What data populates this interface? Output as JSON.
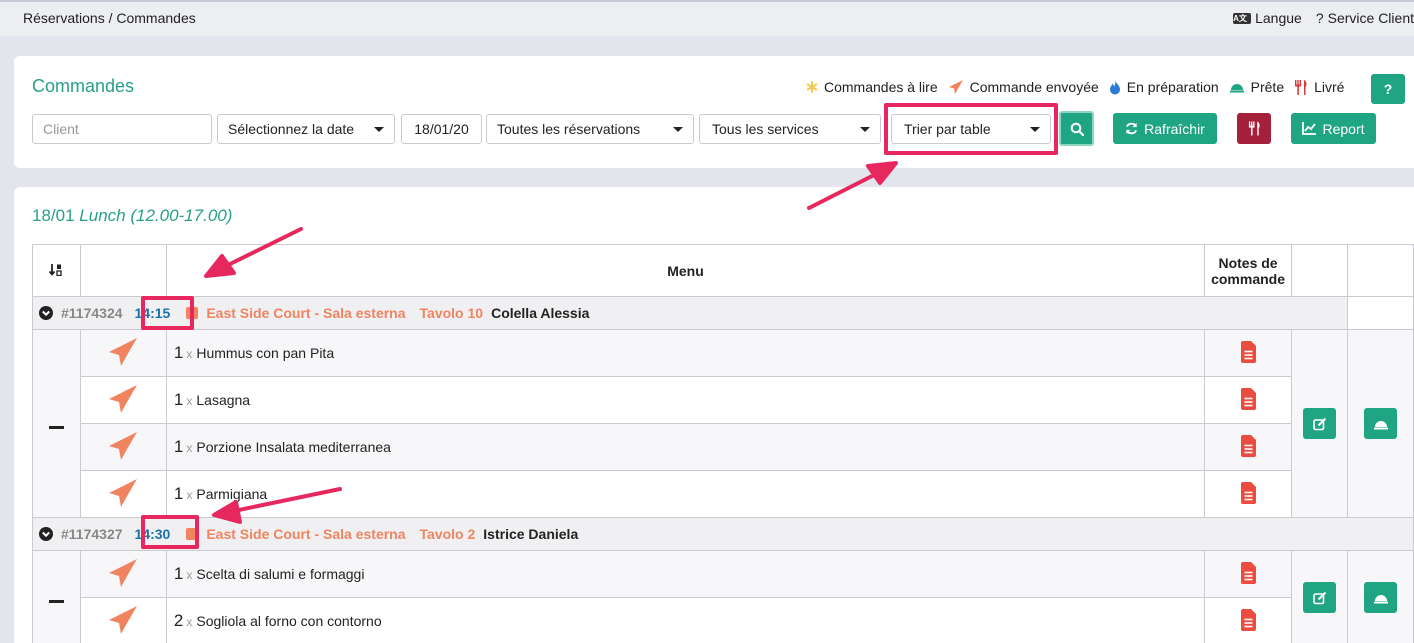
{
  "breadcrumb": "Réservations / Commandes",
  "topnav": {
    "language": "Langue",
    "support": "Service Client"
  },
  "header": {
    "title": "Commandes"
  },
  "legend": [
    {
      "label": "Commandes à lire",
      "icon": "asterisk-icon",
      "color": "#f2c94c"
    },
    {
      "label": "Commande envoyée",
      "icon": "paper-plane-icon",
      "color": "#f0845f"
    },
    {
      "label": "En préparation",
      "icon": "fire-icon",
      "color": "#2b7bd6"
    },
    {
      "label": "Prête",
      "icon": "cloche-icon",
      "color": "#1fa584"
    },
    {
      "label": "Livré",
      "icon": "utensils-icon",
      "color": "#d63b3b"
    }
  ],
  "help_label": "?",
  "filters": {
    "client_placeholder": "Client",
    "date_select": "Sélectionnez la date",
    "date_value": "18/01/20",
    "reservations_select": "Toutes les réservations",
    "services_select": "Tous les services",
    "sort_select": "Trier par table"
  },
  "buttons": {
    "refresh": "Rafraîchir",
    "report": "Report"
  },
  "section": {
    "date": "18/01",
    "service": "Lunch (12.00-17.00)"
  },
  "table_headers": {
    "menu": "Menu",
    "notes": "Notes de commande"
  },
  "orders": [
    {
      "id": "#1174324",
      "time": "14:15",
      "venue": "East Side Court - Sala esterna",
      "table": "Tavolo 10",
      "guest": "Colella Alessia",
      "items": [
        {
          "qty": "1",
          "x": "x",
          "name": "Hummus con pan Pita"
        },
        {
          "qty": "1",
          "x": "x",
          "name": "Lasagna"
        },
        {
          "qty": "1",
          "x": "x",
          "name": "Porzione Insalata mediterranea"
        },
        {
          "qty": "1",
          "x": "x",
          "name": "Parmigiana"
        }
      ]
    },
    {
      "id": "#1174327",
      "time": "14:30",
      "venue": "East Side Court - Sala esterna",
      "table": "Tavolo 2",
      "guest": "Istrice Daniela",
      "items": [
        {
          "qty": "1",
          "x": "x",
          "name": "Scelta di salumi e formaggi"
        },
        {
          "qty": "2",
          "x": "x",
          "name": "Sogliola al forno con contorno"
        }
      ]
    }
  ],
  "colors": {
    "accent": "#1fa584",
    "title": "#27a08a",
    "orange": "#f0845f",
    "highlight": "#e6285e",
    "delete_red": "#a4203b"
  }
}
